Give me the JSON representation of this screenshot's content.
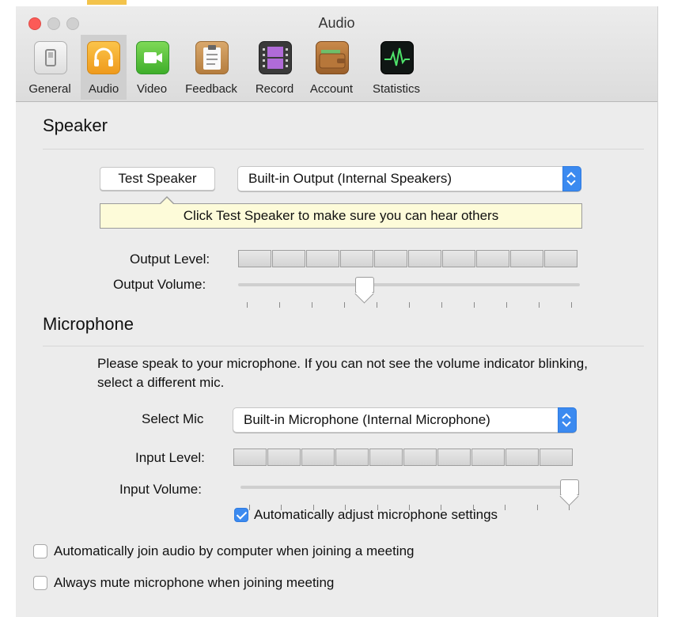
{
  "window": {
    "title": "Audio"
  },
  "toolbar": {
    "items": [
      {
        "label": "General"
      },
      {
        "label": "Audio"
      },
      {
        "label": "Video"
      },
      {
        "label": "Feedback"
      },
      {
        "label": "Record"
      },
      {
        "label": "Account"
      },
      {
        "label": "Statistics"
      }
    ],
    "active": "Audio"
  },
  "speaker": {
    "title": "Speaker",
    "test_button": "Test Speaker",
    "device": "Built-in Output (Internal Speakers)",
    "tooltip": "Click Test Speaker to make sure you can hear others",
    "output_level_label": "Output Level:",
    "output_level_segments": 10,
    "output_level_value": 0,
    "output_volume_label": "Output Volume:",
    "output_volume_value": 0.36
  },
  "microphone": {
    "title": "Microphone",
    "hint": "Please speak to your microphone. If you can not see the volume indicator blinking, select a different mic.",
    "select_mic_label": "Select Mic",
    "device": "Built-in Microphone (Internal Microphone)",
    "input_level_label": "Input Level:",
    "input_level_segments": 10,
    "input_level_value": 0,
    "input_volume_label": "Input Volume:",
    "input_volume_value": 1.0,
    "auto_adjust_label": "Automatically adjust microphone settings",
    "auto_adjust_checked": true
  },
  "options": {
    "auto_join_label": "Automatically join audio by computer when joining a meeting",
    "auto_join_checked": false,
    "always_mute_label": "Always mute microphone when joining meeting",
    "always_mute_checked": false
  },
  "colors": {
    "accent": "#3b8af0",
    "close": "#fc5b57",
    "tooltip_bg": "#fdfbd9"
  }
}
